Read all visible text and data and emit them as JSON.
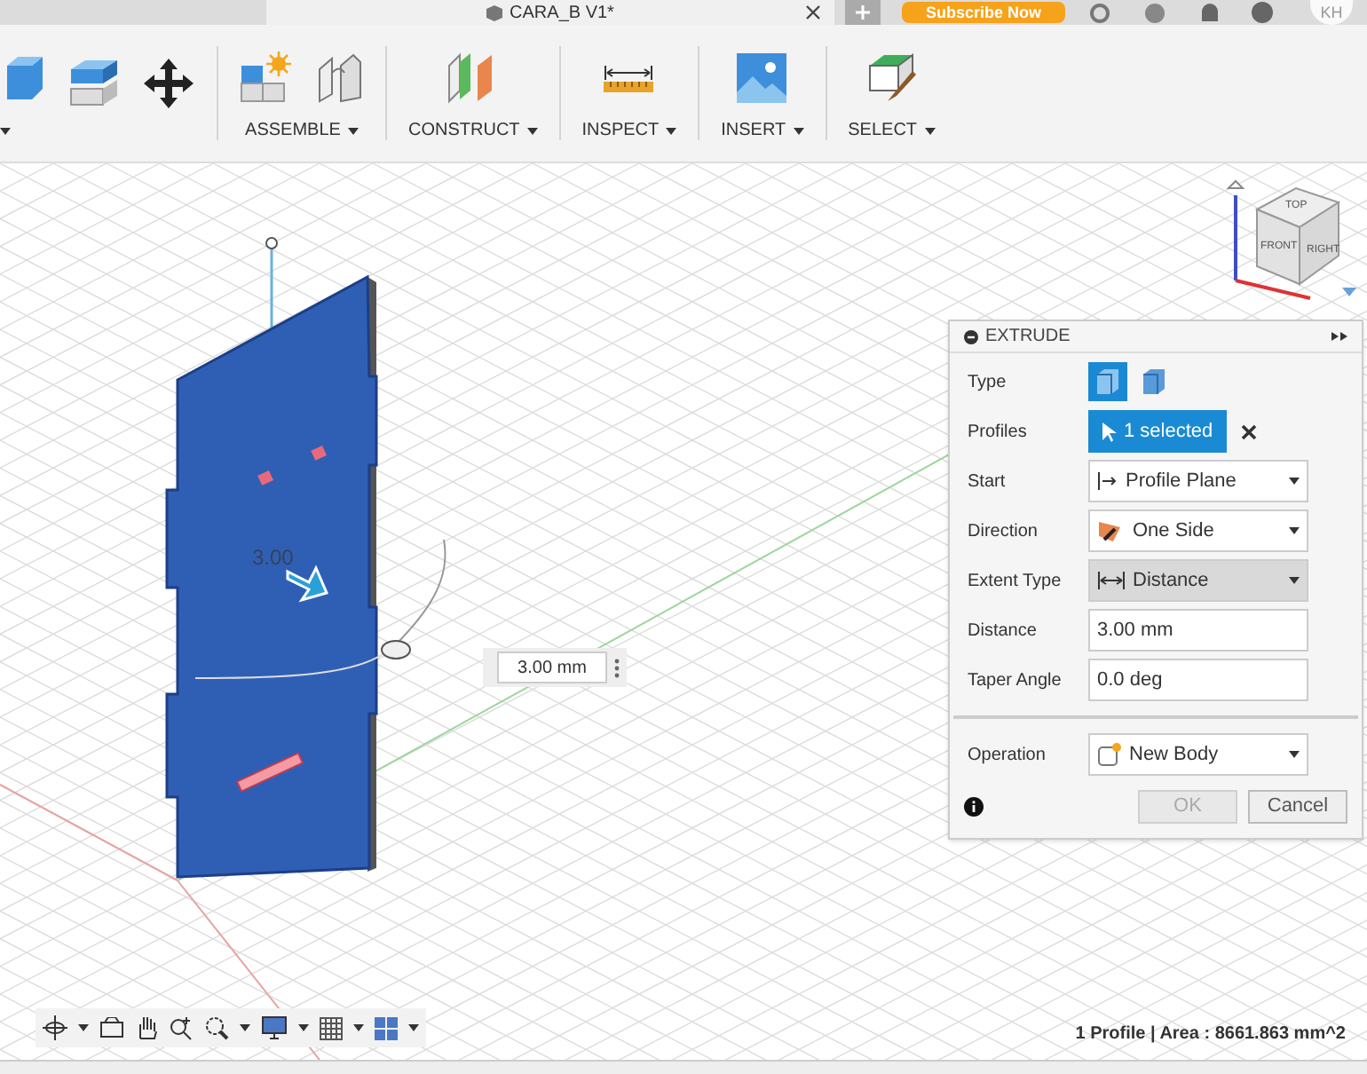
{
  "document_tab": {
    "title": "CARA_B V1*"
  },
  "header": {
    "subscribe_label": "Subscribe Now",
    "avatar": "KH"
  },
  "toolbar": {
    "groups": [
      {
        "kind": "modify"
      },
      {
        "kind": "assemble",
        "label": "ASSEMBLE"
      },
      {
        "kind": "construct",
        "label": "CONSTRUCT"
      },
      {
        "kind": "inspect",
        "label": "INSPECT"
      },
      {
        "kind": "insert",
        "label": "INSERT"
      },
      {
        "kind": "select",
        "label": "SELECT"
      }
    ]
  },
  "viewport": {
    "dimension_label": "3.00",
    "dimension_input": {
      "value": "3.00 mm"
    },
    "view_cube": {
      "faces": [
        "TOP",
        "FRONT",
        "RIGHT"
      ]
    }
  },
  "extrude_panel": {
    "title": "EXTRUDE",
    "rows": [
      {
        "label": "Type",
        "kind": "type",
        "options": [
          {
            "kind": "solid",
            "selected": true
          },
          {
            "kind": "surface",
            "selected": false
          }
        ]
      },
      {
        "label": "Profiles",
        "kind": "selection",
        "value": "1 selected"
      },
      {
        "label": "Start",
        "kind": "dropdown",
        "value": "Profile Plane",
        "highlighted": false
      },
      {
        "label": "Direction",
        "kind": "dropdown",
        "value": "One Side",
        "highlighted": false
      },
      {
        "label": "Extent Type",
        "kind": "dropdown",
        "value": "Distance",
        "highlighted": true
      },
      {
        "label": "Distance",
        "kind": "input",
        "value": "3.00 mm"
      },
      {
        "label": "Taper Angle",
        "kind": "input",
        "value": "0.0 deg"
      }
    ],
    "operation": {
      "label": "Operation",
      "value": "New Body"
    },
    "buttons": [
      {
        "label": "OK",
        "disabled": true
      },
      {
        "label": "Cancel",
        "disabled": false
      }
    ]
  },
  "status_bar": {
    "text": "1 Profile | Area : 8661.863 mm^2"
  }
}
